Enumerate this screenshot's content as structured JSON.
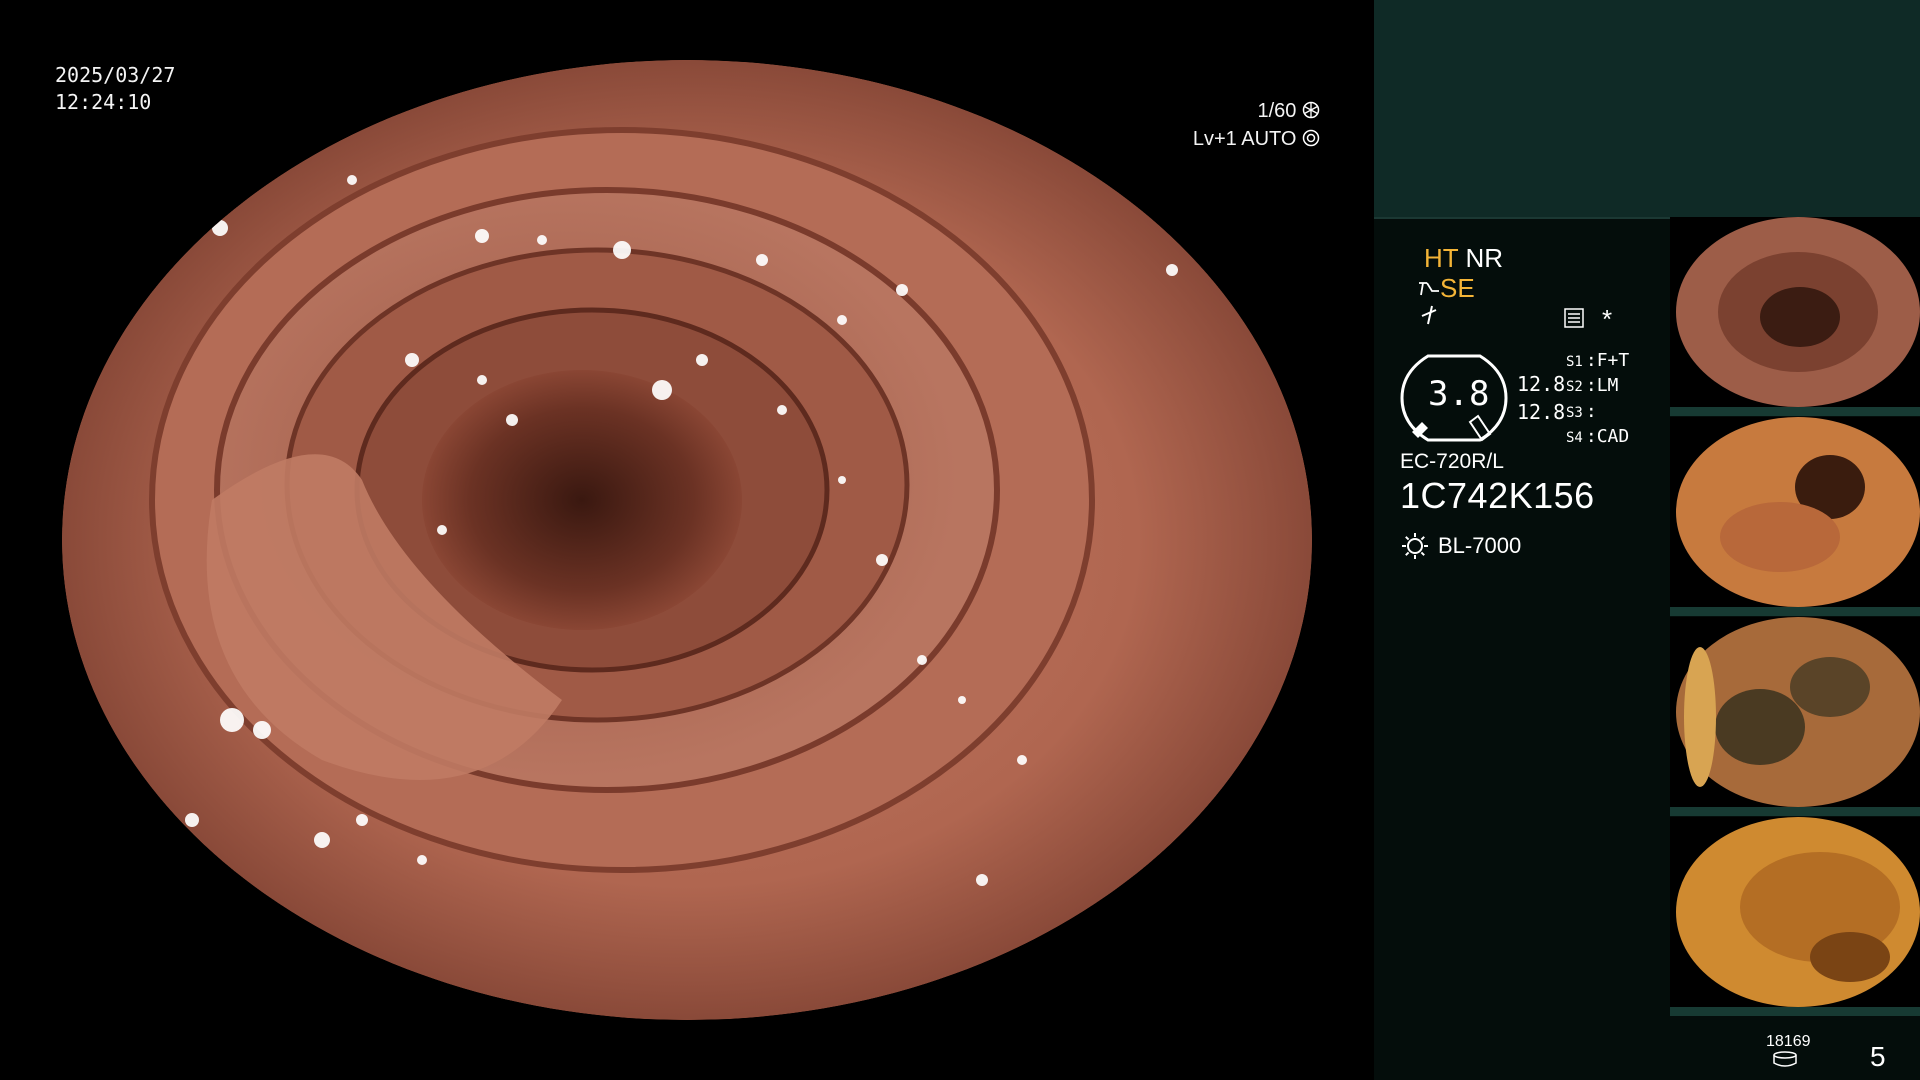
{
  "overlay": {
    "date": "2025/03/27",
    "time": "12:24:10",
    "shutter": "1/60",
    "level": "Lv+1",
    "iris": "AUTO"
  },
  "panel": {
    "mode_ht": "HT",
    "mode_nr": "NR",
    "mode_se": "SE",
    "star": "*",
    "gauge_value": "3.8",
    "gauge_side_1": "12.8",
    "gauge_side_2": "12.8",
    "switches": [
      {
        "key": "S1",
        "value": "F+T"
      },
      {
        "key": "S2",
        "value": "LM"
      },
      {
        "key": "S3",
        "value": ""
      },
      {
        "key": "S4",
        "value": "CAD"
      }
    ],
    "scope_model": "EC-720R/L",
    "serial": "1C742K156",
    "light_source": "BL-7000",
    "counter": "18169",
    "page": "5"
  },
  "colors": {
    "amber": "#f4b437",
    "panel_top": "#0f2a26",
    "panel_bg": "#040d0b"
  },
  "icons": [
    "shutter-icon",
    "iris-icon",
    "menu-icon",
    "lamp-icon",
    "database-icon"
  ]
}
